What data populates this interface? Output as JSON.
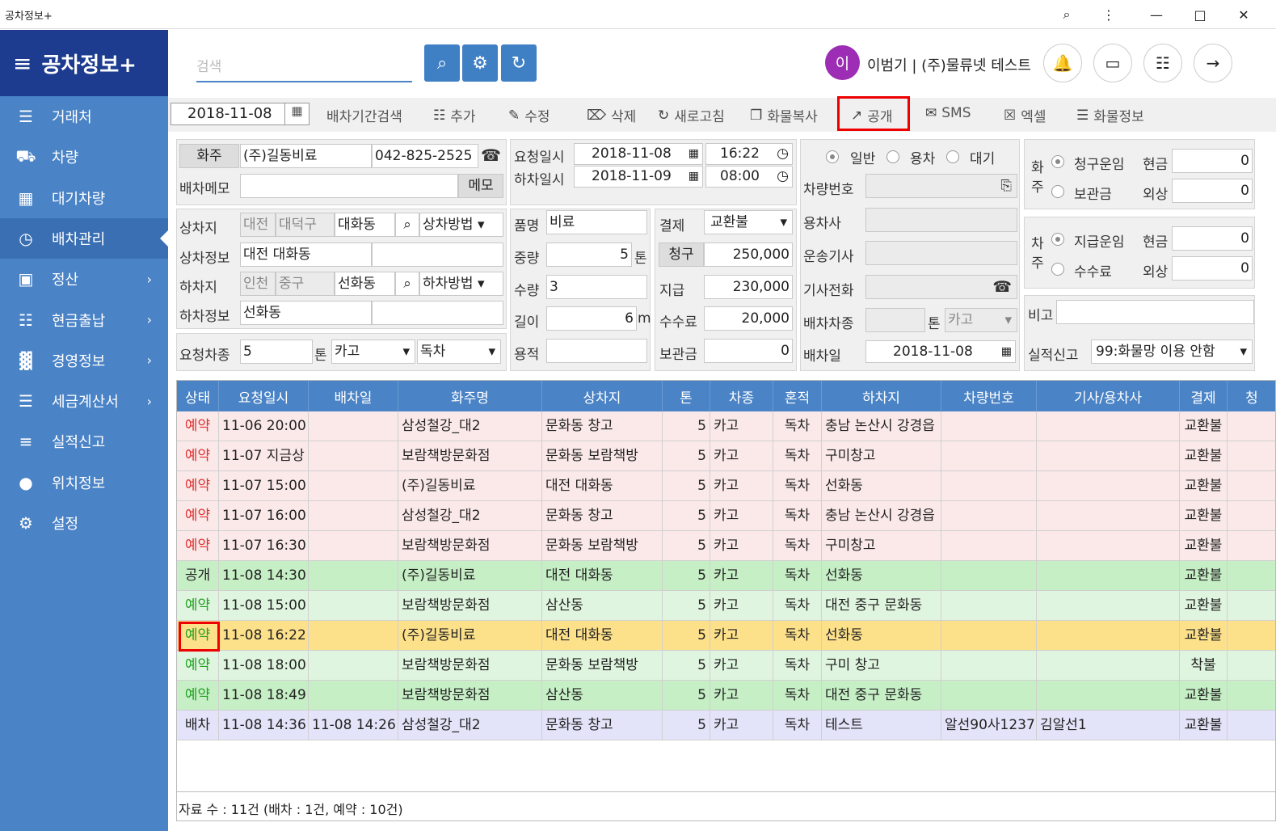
{
  "window": {
    "title": "공차정보+"
  },
  "brand": {
    "title": "공차정보+"
  },
  "sidebar": {
    "items": [
      {
        "label": "거래처",
        "icon": "contact-card-icon",
        "chevron": false
      },
      {
        "label": "차량",
        "icon": "truck-icon",
        "chevron": false
      },
      {
        "label": "대기차량",
        "icon": "calendar-icon",
        "chevron": false
      },
      {
        "label": "배차관리",
        "icon": "clock-icon",
        "chevron": false,
        "active": true
      },
      {
        "label": "정산",
        "icon": "money-icon",
        "chevron": true
      },
      {
        "label": "현금출납",
        "icon": "document-icon",
        "chevron": true
      },
      {
        "label": "경영정보",
        "icon": "bar-chart-icon",
        "chevron": true
      },
      {
        "label": "세금계산서",
        "icon": "invoice-icon",
        "chevron": true
      },
      {
        "label": "실적신고",
        "icon": "list-icon",
        "chevron": false
      },
      {
        "label": "위치정보",
        "icon": "globe-icon",
        "chevron": false
      },
      {
        "label": "설정",
        "icon": "gears-icon",
        "chevron": false
      }
    ]
  },
  "header": {
    "search_placeholder": "검색",
    "avatar_text": "이",
    "user_label": "이범기 | (주)물류넷 테스트"
  },
  "toolbar": {
    "date": "2018-11-08",
    "items": [
      "배차기간검색",
      "추가",
      "수정",
      "삭제",
      "새로고침",
      "화물복사",
      "공개",
      "SMS",
      "엑셀",
      "화물정보"
    ]
  },
  "form": {
    "shipper_label": "화주",
    "shipper_value": "(주)길동비료",
    "shipper_phone": "042-825-2525",
    "memo_label": "배차메모",
    "memo_button": "메모",
    "load_label": "상차지",
    "load_city": "대전",
    "load_district": "대덕구",
    "load_dong": "대화동",
    "load_method": "상차방법",
    "load_info_label": "상차정보",
    "load_info": "대전 대화동",
    "unload_label": "하차지",
    "unload_city": "인천",
    "unload_district": "중구",
    "unload_dong": "선화동",
    "unload_method": "하차방법",
    "unload_info_label": "하차정보",
    "unload_info": "선화동",
    "req_car_label": "요청차종",
    "req_ton": "5",
    "ton_label": "톤",
    "req_type": "카고",
    "req_mode": "독차",
    "req_dt_label": "요청일시",
    "req_date": "2018-11-08",
    "req_time": "16:22",
    "unload_dt_label": "하차일시",
    "unload_date": "2018-11-09",
    "unload_time": "08:00",
    "item_label": "품명",
    "item_value": "비료",
    "weight_label": "중량",
    "weight_value": "5",
    "weight_unit": "톤",
    "qty_label": "수량",
    "qty_value": "3",
    "length_label": "길이",
    "length_value": "6",
    "length_unit": "m",
    "volume_label": "용적",
    "volume_value": "",
    "pay_label": "결제",
    "pay_value": "교환불",
    "claim_label": "청구",
    "claim_value": "250,000",
    "paid_label": "지급",
    "paid_value": "230,000",
    "fee_label": "수수료",
    "fee_value": "20,000",
    "storage_label": "보관금",
    "storage_value": "0",
    "radio_general": "일반",
    "radio_hire": "용차",
    "radio_wait": "대기",
    "car_no_label": "차량번호",
    "hire_label": "용차사",
    "driver_label": "운송기사",
    "driver_phone_label": "기사전화",
    "dispatch_type_label": "배차차종",
    "dispatch_ton_label": "톤",
    "dispatch_type": "카고",
    "dispatch_date_label": "배차일",
    "dispatch_date": "2018-11-08",
    "shipper_side": "화주",
    "shipper_r1": "청구운임",
    "shipper_r2": "보관금",
    "cash": "현금",
    "credit": "외상",
    "s_cash_val": "0",
    "s_credit_val": "0",
    "owner_side": "차주",
    "owner_r1": "지급운임",
    "owner_r2": "수수료",
    "o_cash_val": "0",
    "o_credit_val": "0",
    "note_label": "비고",
    "perf_label": "실적신고",
    "perf_value": "99:화물망 이용 안함"
  },
  "grid": {
    "columns": [
      "상태",
      "요청일시",
      "배차일",
      "화주명",
      "상차지",
      "톤",
      "차종",
      "혼적",
      "하차지",
      "차량번호",
      "기사/용차사",
      "결제",
      "청"
    ],
    "rows": [
      {
        "status": "예약",
        "req": "11-06 20:00",
        "disp": "",
        "shipper": "삼성철강_대2",
        "load": "문화동 창고",
        "ton": "5",
        "type": "카고",
        "mix": "독차",
        "unload": "충남 논산시 강경읍",
        "car": "",
        "driver": "",
        "pay": "교환불",
        "cls": "pink"
      },
      {
        "status": "예약",
        "req": "11-07 지금상",
        "disp": "",
        "shipper": "보람책방문화점",
        "load": "문화동 보람책방",
        "ton": "5",
        "type": "카고",
        "mix": "독차",
        "unload": "구미창고",
        "car": "",
        "driver": "",
        "pay": "교환불",
        "cls": "pink"
      },
      {
        "status": "예약",
        "req": "11-07 15:00",
        "disp": "",
        "shipper": "(주)길동비료",
        "load": "대전 대화동",
        "ton": "5",
        "type": "카고",
        "mix": "독차",
        "unload": "선화동",
        "car": "",
        "driver": "",
        "pay": "교환불",
        "cls": "pink"
      },
      {
        "status": "예약",
        "req": "11-07 16:00",
        "disp": "",
        "shipper": "삼성철강_대2",
        "load": "문화동 창고",
        "ton": "5",
        "type": "카고",
        "mix": "독차",
        "unload": "충남 논산시 강경읍",
        "car": "",
        "driver": "",
        "pay": "교환불",
        "cls": "pink"
      },
      {
        "status": "예약",
        "req": "11-07 16:30",
        "disp": "",
        "shipper": "보람책방문화점",
        "load": "문화동 보람책방",
        "ton": "5",
        "type": "카고",
        "mix": "독차",
        "unload": "구미창고",
        "car": "",
        "driver": "",
        "pay": "교환불",
        "cls": "pink"
      },
      {
        "status": "공개",
        "req": "11-08 14:30",
        "disp": "",
        "shipper": "(주)길동비료",
        "load": "대전 대화동",
        "ton": "5",
        "type": "카고",
        "mix": "독차",
        "unload": "선화동",
        "car": "",
        "driver": "",
        "pay": "교환불",
        "cls": "green"
      },
      {
        "status": "예약",
        "req": "11-08 15:00",
        "disp": "",
        "shipper": "보람책방문화점",
        "load": "삼산동",
        "ton": "5",
        "type": "카고",
        "mix": "독차",
        "unload": "대전 중구 문화동",
        "car": "",
        "driver": "",
        "pay": "교환불",
        "cls": "lgreen"
      },
      {
        "status": "예약",
        "req": "11-08 16:22",
        "disp": "",
        "shipper": "(주)길동비료",
        "load": "대전 대화동",
        "ton": "5",
        "type": "카고",
        "mix": "독차",
        "unload": "선화동",
        "car": "",
        "driver": "",
        "pay": "교환불",
        "cls": "yellow"
      },
      {
        "status": "예약",
        "req": "11-08 18:00",
        "disp": "",
        "shipper": "보람책방문화점",
        "load": "문화동 보람책방",
        "ton": "5",
        "type": "카고",
        "mix": "독차",
        "unload": "구미 창고",
        "car": "",
        "driver": "",
        "pay": "착불",
        "cls": "lgreen"
      },
      {
        "status": "예약",
        "req": "11-08 18:49",
        "disp": "",
        "shipper": "보람책방문화점",
        "load": "삼산동",
        "ton": "5",
        "type": "카고",
        "mix": "독차",
        "unload": "대전 중구 문화동",
        "car": "",
        "driver": "",
        "pay": "교환불",
        "cls": "green"
      },
      {
        "status": "배차",
        "req": "11-08 14:36",
        "disp": "11-08 14:26",
        "shipper": "삼성철강_대2",
        "load": "문화동 창고",
        "ton": "5",
        "type": "카고",
        "mix": "독차",
        "unload": "테스트",
        "car": "알선90사1237",
        "driver": "김알선1",
        "pay": "교환불",
        "cls": "lav"
      }
    ],
    "footer": "자료 수 : 11건 (배차 : 1건, 예약 : 10건)"
  },
  "colors": {
    "sidebar": "#4a83c6",
    "brand": "#1d3c8f",
    "pink": "#fbe9e9",
    "green": "#c6efc6",
    "lgreen": "#dff5df",
    "yellow": "#fde08a",
    "lav": "#e3e3f9",
    "status_red": "#e03030",
    "status_green": "#22a022"
  }
}
